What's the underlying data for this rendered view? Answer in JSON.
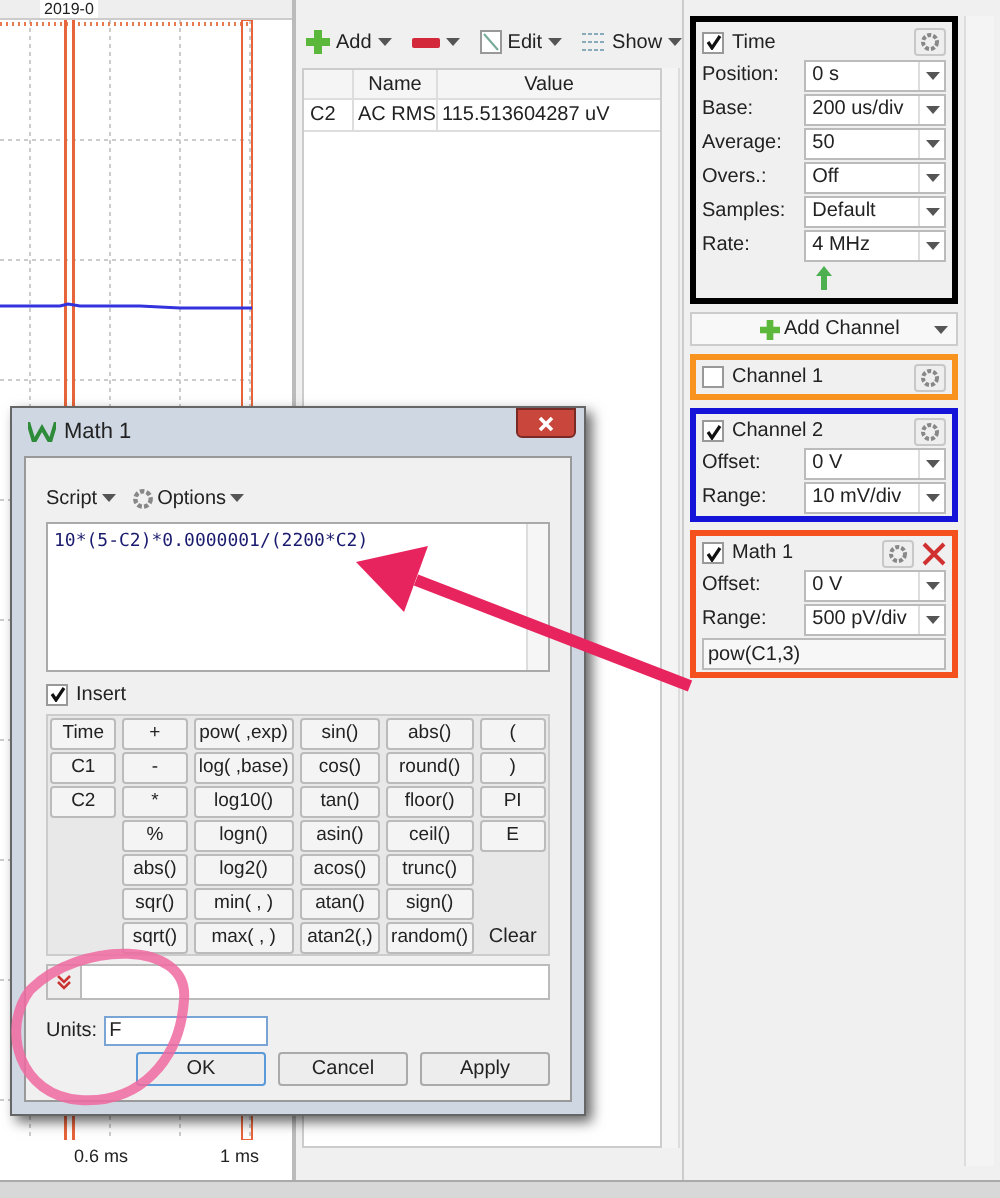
{
  "plot": {
    "toolbar_text": "2019-0",
    "x_labels": [
      "0.6 ms",
      "1 ms"
    ]
  },
  "measurements": {
    "toolbar": [
      {
        "kind": "add",
        "label": "Add"
      },
      {
        "kind": "remove"
      },
      {
        "kind": "edit",
        "label": "Edit"
      },
      {
        "kind": "show",
        "label": "Show"
      }
    ],
    "columns": [
      "",
      "Name",
      "Value"
    ],
    "rows": [
      [
        "C2",
        "AC RMS",
        "115.513604287 uV"
      ]
    ]
  },
  "time": {
    "label": "Time",
    "checked": true,
    "fields": [
      {
        "label": "Position:",
        "value": "0 s"
      },
      {
        "label": "Base:",
        "value": "200 us/div"
      },
      {
        "label": "Average:",
        "value": "50"
      },
      {
        "label": "Overs.:",
        "value": "Off"
      },
      {
        "label": "Samples:",
        "value": "Default"
      },
      {
        "label": "Rate:",
        "value": "4 MHz"
      }
    ]
  },
  "add_channel": "Add Channel",
  "channels": [
    {
      "label": "Channel 1",
      "checked": false,
      "color": "#f7931e",
      "removable": false
    },
    {
      "label": "Channel 2",
      "checked": true,
      "color": "#1414d8",
      "removable": false,
      "fields": [
        {
          "label": "Offset:",
          "value": "0 V"
        },
        {
          "label": "Range:",
          "value": "10 mV/div"
        }
      ]
    },
    {
      "label": "Math 1",
      "checked": true,
      "color": "#f4511e",
      "removable": true,
      "fields": [
        {
          "label": "Offset:",
          "value": "0 V"
        },
        {
          "label": "Range:",
          "value": "500 pV/div"
        }
      ],
      "formula": "pow(C1,3)"
    }
  ],
  "dialog": {
    "title": "Math 1",
    "menus": [
      "Script",
      "Options"
    ],
    "expression": "10*(5-C2)*0.0000001/(2200*C2)",
    "insert": {
      "label": "Insert",
      "checked": true
    },
    "key_columns": [
      [
        "Time",
        "C1",
        "C2"
      ],
      [
        "+",
        "-",
        "*",
        "%",
        "abs()",
        "sqr()",
        "sqrt()"
      ],
      [
        "pow( ,exp)",
        "log( ,base)",
        "log10()",
        "logn()",
        "log2()",
        "min( , )",
        "max( , )"
      ],
      [
        "sin()",
        "cos()",
        "tan()",
        "asin()",
        "acos()",
        "atan()",
        "atan2(,)"
      ],
      [
        "abs()",
        "round()",
        "floor()",
        "ceil()",
        "trunc()",
        "sign()",
        "random()"
      ],
      [
        "(",
        ")",
        "PI",
        "E"
      ]
    ],
    "clear": "Clear",
    "units_label": "Units:",
    "units": "F",
    "buttons": [
      "OK",
      "Cancel",
      "Apply"
    ]
  }
}
